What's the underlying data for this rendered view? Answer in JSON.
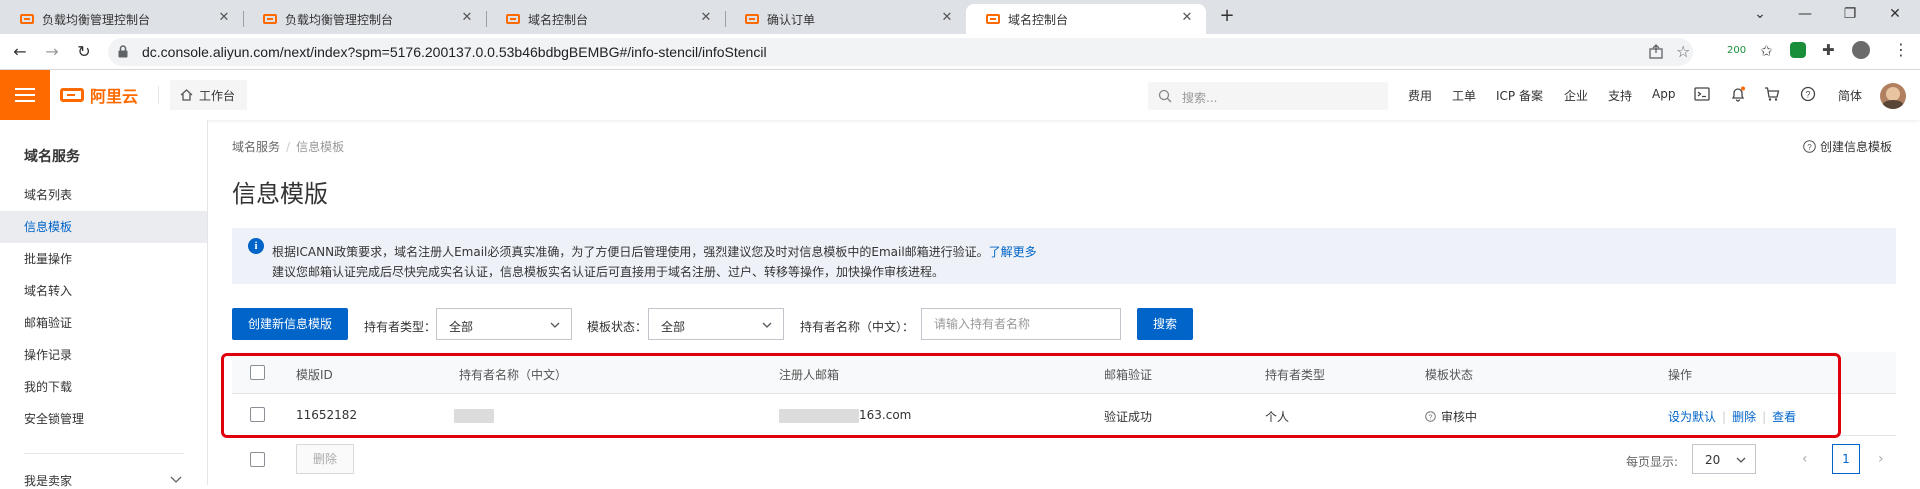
{
  "browser": {
    "tabs": [
      {
        "title": "负载均衡管理控制台",
        "active": false
      },
      {
        "title": "负载均衡管理控制台",
        "active": false
      },
      {
        "title": "域名控制台",
        "active": false
      },
      {
        "title": "确认订单",
        "active": false
      },
      {
        "title": "域名控制台",
        "active": true
      }
    ],
    "url": "dc.console.aliyun.com/next/index?spm=5176.200137.0.0.53b46bdbgBEMBG#/info-stencil/infoStencil",
    "extension_badge": "200"
  },
  "topbar": {
    "logo_text": "阿里云",
    "workbench": "工作台",
    "search_placeholder": "搜索...",
    "nav": [
      "费用",
      "工单",
      "ICP 备案",
      "企业",
      "支持",
      "App"
    ],
    "language": "简体"
  },
  "sidebar": {
    "title": "域名服务",
    "items": [
      {
        "label": "域名列表",
        "active": false
      },
      {
        "label": "信息模板",
        "active": true
      },
      {
        "label": "批量操作",
        "active": false
      },
      {
        "label": "域名转入",
        "active": false
      },
      {
        "label": "邮箱验证",
        "active": false
      },
      {
        "label": "操作记录",
        "active": false
      },
      {
        "label": "我的下载",
        "active": false
      },
      {
        "label": "安全锁管理",
        "active": false
      }
    ],
    "bottom_item": "我是卖家"
  },
  "breadcrumb": [
    "域名服务",
    "信息模板"
  ],
  "help_link": "创建信息模板",
  "page_title": "信息模版",
  "notice": {
    "line1": "根据ICANN政策要求，域名注册人Email必须真实准确，为了方便日后管理使用，强烈建议您及时对信息模板中的Email邮箱进行验证。",
    "link": "了解更多",
    "line2": "建议您邮箱认证完成后尽快完成实名认证，信息模板实名认证后可直接用于域名注册、过户、转移等操作，加快操作审核进程。"
  },
  "filters": {
    "create_button": "创建新信息模版",
    "holder_type_label": "持有者类型：",
    "holder_type_value": "全部",
    "status_label": "模板状态：",
    "status_value": "全部",
    "name_label": "持有者名称（中文）：",
    "name_placeholder": "请输入持有者名称",
    "search_button": "搜索"
  },
  "table": {
    "columns": [
      "模版ID",
      "持有者名称（中文）",
      "注册人邮箱",
      "邮箱验证",
      "持有者类型",
      "模板状态",
      "操作"
    ],
    "rows": [
      {
        "id": "11652182",
        "email_suffix": "163.com",
        "email_verification": "验证成功",
        "holder_type": "个人",
        "status": "审核中",
        "actions": [
          "设为默认",
          "删除",
          "查看"
        ]
      }
    ]
  },
  "footer": {
    "delete_button": "删除",
    "per_page_label": "每页显示:",
    "per_page_value": "20",
    "current_page": "1"
  },
  "colors": {
    "brand": "#ff6a00",
    "primary": "#0064c8",
    "highlight": "#e0000b"
  }
}
